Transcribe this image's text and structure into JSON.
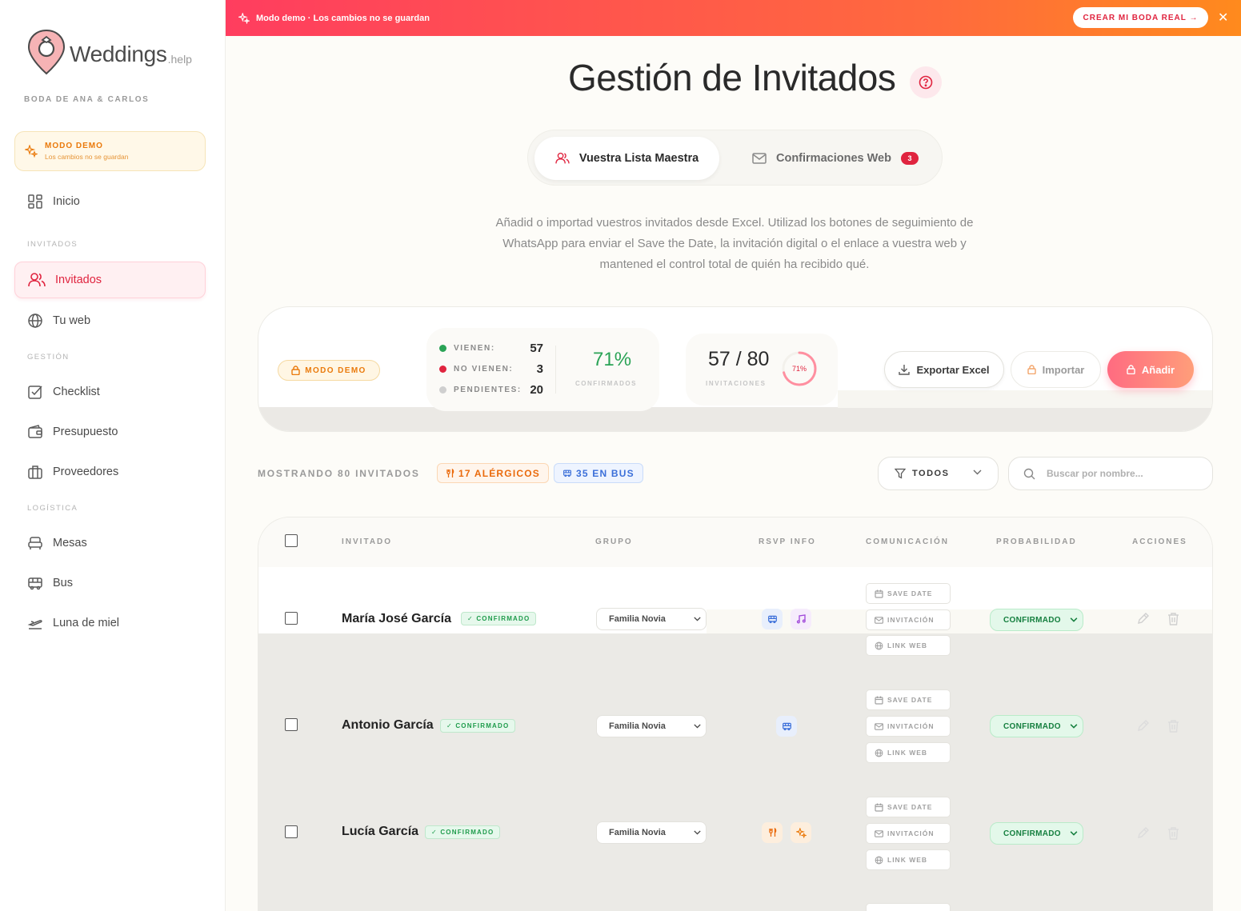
{
  "brand": {
    "name": "Weddings",
    "suffix": ".help",
    "wedding": "BODA DE ANA & CARLOS"
  },
  "sidebar": {
    "demo_title": "MODO DEMO",
    "demo_sub": "Los cambios no se guardan",
    "sections": {
      "invitados": "INVITADOS",
      "gestion": "GESTIÓN",
      "logistica": "LOGÍSTICA"
    },
    "items": [
      {
        "label": "Inicio",
        "icon": "grid-icon"
      },
      {
        "label": "Invitados",
        "icon": "users-icon",
        "active": true
      },
      {
        "label": "Tu web",
        "icon": "globe-icon"
      },
      {
        "label": "Checklist",
        "icon": "checkbox-icon"
      },
      {
        "label": "Presupuesto",
        "icon": "wallet-icon"
      },
      {
        "label": "Proveedores",
        "icon": "briefcase-icon"
      },
      {
        "label": "Mesas",
        "icon": "sofa-icon"
      },
      {
        "label": "Bus",
        "icon": "bus-icon"
      },
      {
        "label": "Luna de miel",
        "icon": "plane-icon"
      }
    ]
  },
  "banner": {
    "text": "Modo demo · Los cambios no se guardan",
    "cta": "CREAR MI BODA REAL →",
    "close": "✕"
  },
  "header": {
    "title": "Gestión de Invitados",
    "tab_master": "Vuestra Lista Maestra",
    "tab_web": "Confirmaciones Web",
    "tab_web_badge": "3",
    "description": "Añadid o importad vuestros invitados desde Excel. Utilizad los botones de seguimiento de WhatsApp para enviar el Save the Date, la invitación digital o el enlace a vuestra web y mantened el control total de quién ha recibido qué."
  },
  "stats": {
    "demo_label": "MODO DEMO",
    "vienen_label": "VIENEN:",
    "vienen": "57",
    "no_vienen_label": "NO VIENEN:",
    "no_vienen": "3",
    "pendientes_label": "PENDIENTES:",
    "pendientes": "20",
    "confirm_pct": "71%",
    "confirm_label": "CONFIRMADOS",
    "invitations": "57 / 80",
    "invitations_label": "INVITACIONES",
    "ring_pct": "71%",
    "ring_value": 0.71,
    "export_label": "Exportar Excel",
    "import_label": "Importar",
    "add_label": "Añadir"
  },
  "filters": {
    "showing": "MOSTRANDO 80 INVITADOS",
    "allergy_chip": "17 ALÉRGICOS",
    "bus_chip": "35 EN BUS",
    "group_filter": "TODOS",
    "search_placeholder": "Buscar por nombre..."
  },
  "table": {
    "headers": {
      "guest": "INVITADO",
      "group": "GRUPO",
      "rsvp": "RSVP INFO",
      "comm": "COMUNICACIÓN",
      "prob": "PROBABILIDAD",
      "actions": "ACCIONES"
    },
    "comm_labels": {
      "save_date": "SAVE DATE",
      "invitation": "INVITACIÓN",
      "web": "LINK WEB"
    },
    "rows": [
      {
        "name": "María José García",
        "status": "✓ CONFIRMADO",
        "group": "Familia Novia",
        "probability": "CONFIRMADO",
        "rsvp_icons": [
          "bus-icon",
          "music-icon"
        ]
      },
      {
        "name": "Antonio García",
        "status": "✓ CONFIRMADO",
        "group": "Familia Novia",
        "probability": "CONFIRMADO",
        "rsvp_icons": [
          "bus-icon"
        ]
      },
      {
        "name": "Lucía García",
        "status": "✓ CONFIRMADO",
        "group": "Familia Novia",
        "probability": "CONFIRMADO",
        "rsvp_icons": [
          "utensils-icon",
          "sparkle-icon"
        ]
      }
    ]
  }
}
